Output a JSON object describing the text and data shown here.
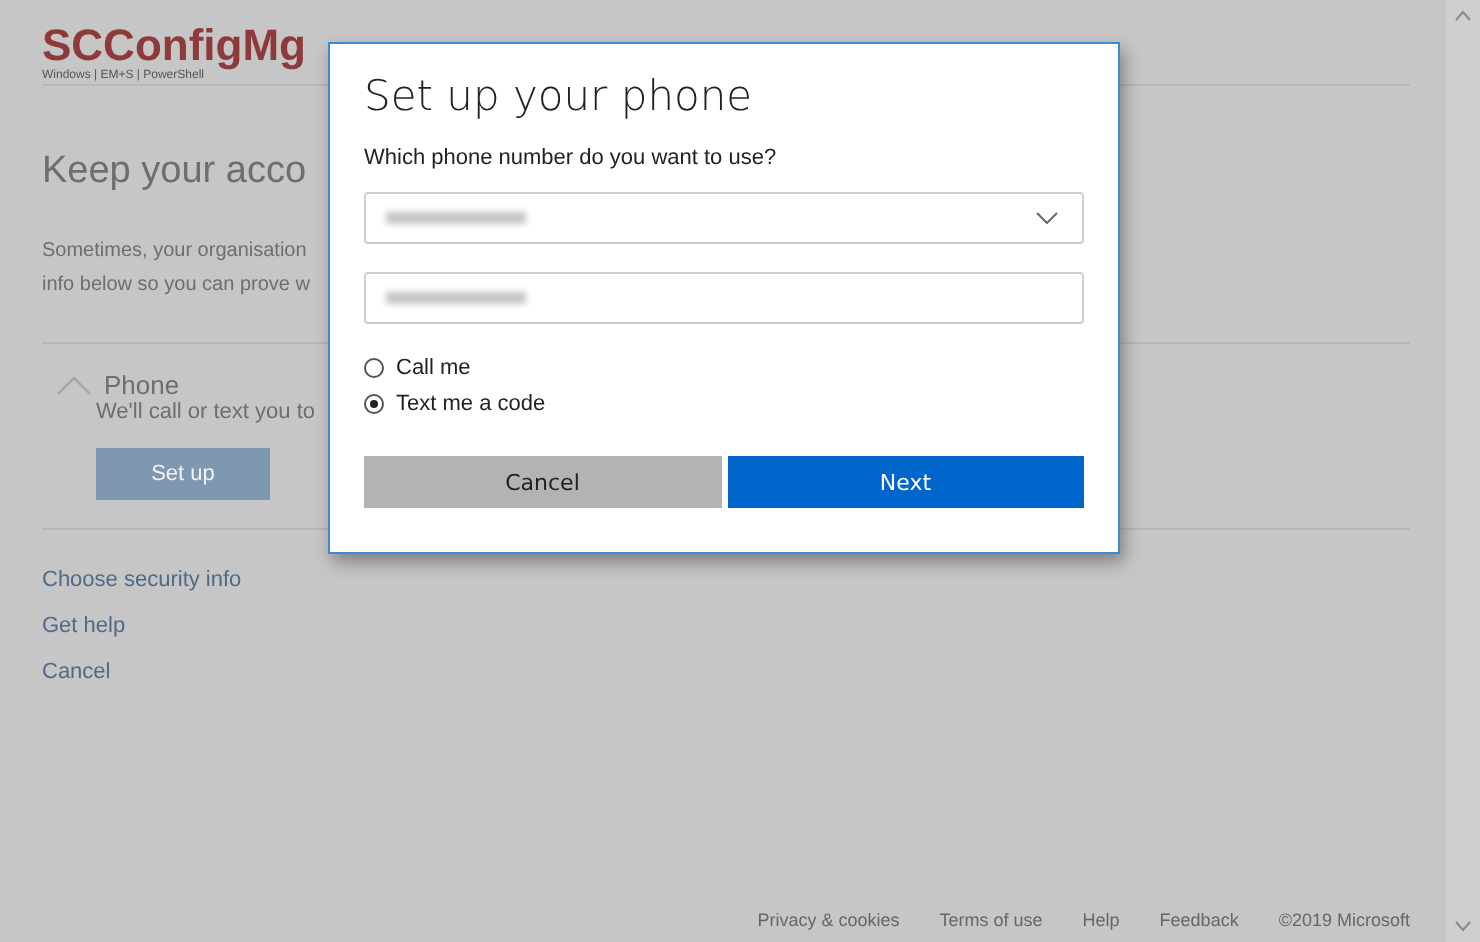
{
  "page": {
    "logo": "SCConfigMg",
    "logo_tagline": "Windows | EM+S | PowerShell",
    "heading": "Keep your acco",
    "intro_lines": [
      "Sometimes, your organisation",
      "info below so you can prove w"
    ],
    "method": {
      "title": "Phone",
      "expanded": true,
      "description": "We'll call or text you to",
      "button": "Set up"
    },
    "links": [
      "Choose security info",
      "Get help",
      "Cancel"
    ],
    "footer": [
      "Privacy & cookies",
      "Terms of use",
      "Help",
      "Feedback",
      "©2019 Microsoft"
    ]
  },
  "dialog": {
    "title": "Set up your phone",
    "question": "Which phone number do you want to use?",
    "options": [
      {
        "label": "Call me",
        "selected": false
      },
      {
        "label": "Text me a code",
        "selected": true
      }
    ],
    "buttons": [
      {
        "label": "Cancel",
        "kind": "secondary"
      },
      {
        "label": "Next",
        "kind": "primary"
      }
    ]
  }
}
